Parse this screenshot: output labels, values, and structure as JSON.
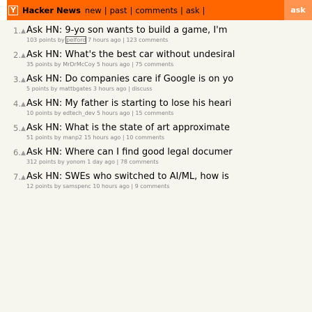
{
  "header": {
    "logo": "Y",
    "brand": "Hacker News",
    "links": [
      "new",
      "past",
      "comments",
      "ask"
    ],
    "right_tab": "ask"
  },
  "items": [
    {
      "rank": "1.",
      "title": "Ask HN: 9-yo son wants to build a game, I'm",
      "points": "103 points",
      "user": "pelford",
      "age": "7 hours ago",
      "comments": "123 comments"
    },
    {
      "rank": "2.",
      "title": "Ask HN: What's the best car without undesiral",
      "points": "35 points",
      "user": "MrDrMcCoy",
      "age": "5 hours ago",
      "comments": "75 comments"
    },
    {
      "rank": "3.",
      "title": "Ask HN: Do companies care if Google is on yo",
      "points": "5 points",
      "user": "mattbgates",
      "age": "3 hours ago",
      "comments": "discuss"
    },
    {
      "rank": "4.",
      "title": "Ask HN: My father is starting to lose his heari",
      "points": "10 points",
      "user": "edtech_dev",
      "age": "5 hours ago",
      "comments": "15 comments"
    },
    {
      "rank": "5.",
      "title": "Ask HN: What is the state of art approximate",
      "points": "51 points",
      "user": "manp2",
      "age": "15 hours ago",
      "comments": "10 comments"
    },
    {
      "rank": "6.",
      "title": "Ask HN: Where can I find good legal documer",
      "points": "312 points",
      "user": "yonom",
      "age": "1 day ago",
      "comments": "78 comments"
    },
    {
      "rank": "7.",
      "title": "Ask HN: SWEs who switched to AI/ML, how is",
      "points": "12 points",
      "user": "samspenc",
      "age": "10 hours ago",
      "comments": "9 comments"
    }
  ]
}
